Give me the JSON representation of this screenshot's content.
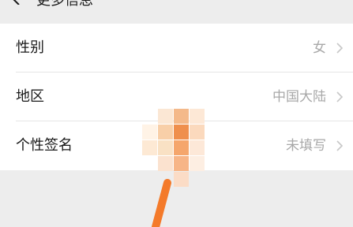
{
  "header": {
    "title": "更多信息",
    "back_icon": "chevron-left-icon"
  },
  "rows": [
    {
      "label": "性别",
      "value": "女"
    },
    {
      "label": "地区",
      "value": "中国大陆"
    },
    {
      "label": "个性签名",
      "value": "未填写"
    }
  ],
  "colors": {
    "background": "#ededed",
    "row_background": "#ffffff",
    "label_text": "#191919",
    "value_text": "#a8a8a8",
    "annotation_stroke": "#f47a2a"
  }
}
